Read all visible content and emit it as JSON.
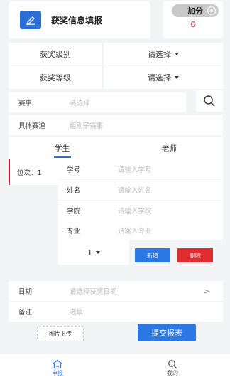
{
  "header": {
    "title": "获奖信息填报",
    "icon": "edit-icon"
  },
  "score": {
    "label": "加分",
    "value": "0",
    "accent": "#e5322d"
  },
  "award_level": {
    "label": "获奖级别",
    "value": "请选择"
  },
  "award_grade": {
    "label": "获奖等级",
    "value": "请选择"
  },
  "event": {
    "label": "赛事",
    "placeholder": "请选择"
  },
  "sub_event": {
    "label": "具体赛道",
    "placeholder": "组别子赛事"
  },
  "tabs": [
    {
      "label": "学生",
      "active": true
    },
    {
      "label": "老师",
      "active": false
    }
  ],
  "position_label": "位次：1",
  "fields": [
    {
      "label": "学号",
      "placeholder": "请输入学号"
    },
    {
      "label": "姓名",
      "placeholder": "请输入姓名"
    },
    {
      "label": "学院",
      "placeholder": "请输入学院"
    },
    {
      "label": "专业",
      "placeholder": "请输入专业"
    }
  ],
  "position_select": "1",
  "add_label": "新增",
  "delete_label": "删除",
  "date": {
    "label": "日期",
    "placeholder": "请选择获奖日期"
  },
  "remark": {
    "label": "备注",
    "placeholder": "选填"
  },
  "upload_label": "图片上传",
  "submit_label": "提交报表",
  "tabbar": [
    {
      "label": "申报",
      "icon": "home-icon",
      "active": true
    },
    {
      "label": "我的",
      "icon": "search-icon",
      "active": false
    }
  ],
  "colors": {
    "primary": "#2b78e4",
    "danger": "#e02b2f",
    "accent_line": "#c8232c"
  }
}
